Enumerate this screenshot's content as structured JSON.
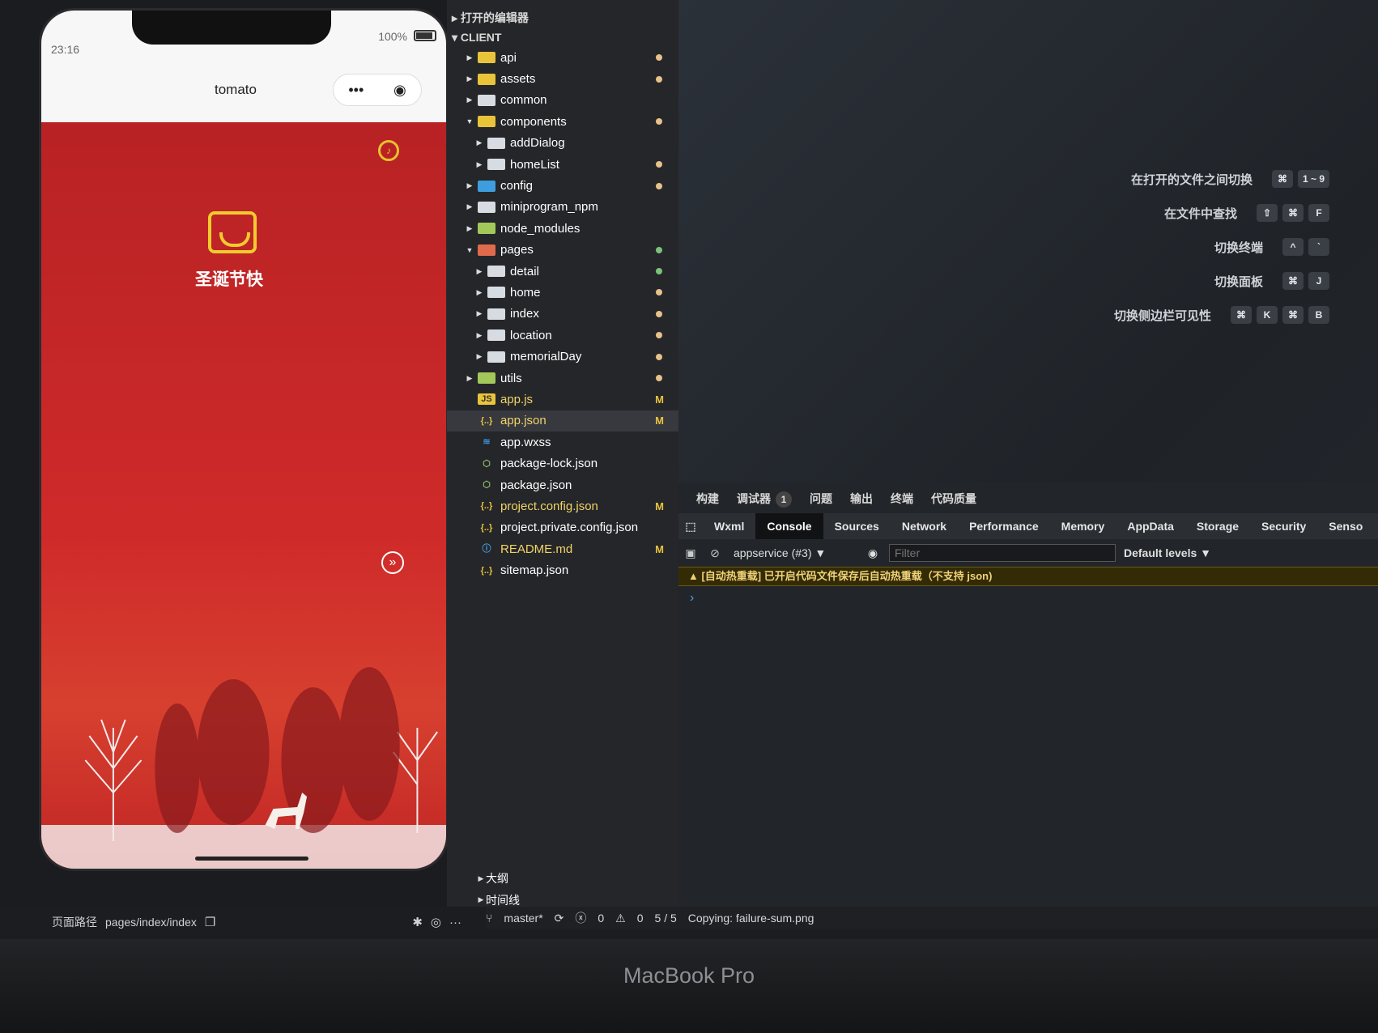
{
  "simulator": {
    "time": "23:16",
    "battery": "100%",
    "nav_title": "tomato",
    "capsule_more": "•••",
    "greeting": "圣诞节快",
    "footer": {
      "path_label": "页面路径",
      "path_value": "pages/index/index"
    }
  },
  "explorer": {
    "open_editors": "打开的编辑器",
    "root": "CLIENT",
    "items": [
      {
        "label": "api",
        "arrow": "▶",
        "icon": "folder-yellow",
        "dot": "#e8c28a",
        "mark": "",
        "indent": 1
      },
      {
        "label": "assets",
        "arrow": "▶",
        "icon": "folder-yellow",
        "dot": "#e8c28a",
        "mark": "",
        "indent": 1
      },
      {
        "label": "common",
        "arrow": "▶",
        "icon": "folder",
        "dot": "",
        "mark": "",
        "indent": 1
      },
      {
        "label": "components",
        "arrow": "▼",
        "icon": "folder-open",
        "dot": "#e8c28a",
        "mark": "",
        "indent": 1
      },
      {
        "label": "addDialog",
        "arrow": "▶",
        "icon": "folder",
        "dot": "",
        "mark": "",
        "indent": 2
      },
      {
        "label": "homeList",
        "arrow": "▶",
        "icon": "folder",
        "dot": "#e8c28a",
        "mark": "",
        "indent": 2
      },
      {
        "label": "config",
        "arrow": "▶",
        "icon": "folder-blue",
        "dot": "#e8c28a",
        "mark": "",
        "indent": 1
      },
      {
        "label": "miniprogram_npm",
        "arrow": "▶",
        "icon": "folder",
        "dot": "",
        "mark": "",
        "indent": 1
      },
      {
        "label": "node_modules",
        "arrow": "▶",
        "icon": "folder-green",
        "dot": "",
        "mark": "",
        "indent": 1
      },
      {
        "label": "pages",
        "arrow": "▼",
        "icon": "folder-red",
        "dot": "#7cc27a",
        "mark": "",
        "indent": 1
      },
      {
        "label": "detail",
        "arrow": "▶",
        "icon": "folder",
        "dot": "#7cc27a",
        "mark": "",
        "indent": 2
      },
      {
        "label": "home",
        "arrow": "▶",
        "icon": "folder",
        "dot": "#e8c28a",
        "mark": "",
        "indent": 2
      },
      {
        "label": "index",
        "arrow": "▶",
        "icon": "folder",
        "dot": "#e8c28a",
        "mark": "",
        "indent": 2
      },
      {
        "label": "location",
        "arrow": "▶",
        "icon": "folder",
        "dot": "#e8c28a",
        "mark": "",
        "indent": 2
      },
      {
        "label": "memorialDay",
        "arrow": "▶",
        "icon": "folder",
        "dot": "#e8c28a",
        "mark": "",
        "indent": 2
      },
      {
        "label": "utils",
        "arrow": "▶",
        "icon": "folder-green",
        "dot": "#e8c28a",
        "mark": "",
        "indent": 1
      },
      {
        "label": "app.js",
        "arrow": "",
        "icon": "js",
        "dot": "",
        "mark": "M",
        "indent": 1
      },
      {
        "label": "app.json",
        "arrow": "",
        "icon": "json",
        "dot": "",
        "mark": "M",
        "indent": 1,
        "selected": true
      },
      {
        "label": "app.wxss",
        "arrow": "",
        "icon": "css",
        "dot": "",
        "mark": "",
        "indent": 1
      },
      {
        "label": "package-lock.json",
        "arrow": "",
        "icon": "npm",
        "dot": "",
        "mark": "",
        "indent": 1
      },
      {
        "label": "package.json",
        "arrow": "",
        "icon": "npm",
        "dot": "",
        "mark": "",
        "indent": 1
      },
      {
        "label": "project.config.json",
        "arrow": "",
        "icon": "json",
        "dot": "",
        "mark": "M",
        "indent": 1
      },
      {
        "label": "project.private.config.json",
        "arrow": "",
        "icon": "json",
        "dot": "",
        "mark": "",
        "indent": 1
      },
      {
        "label": "README.md",
        "arrow": "",
        "icon": "info",
        "dot": "",
        "mark": "M",
        "indent": 1
      },
      {
        "label": "sitemap.json",
        "arrow": "",
        "icon": "json",
        "dot": "",
        "mark": "",
        "indent": 1
      }
    ],
    "outline": "大纲",
    "timeline": "时间线"
  },
  "shortcuts": [
    {
      "label": "在打开的文件之间切换",
      "keys": [
        "⌘",
        "1 ~ 9"
      ]
    },
    {
      "label": "在文件中查找",
      "keys": [
        "⇧",
        "⌘",
        "F"
      ]
    },
    {
      "label": "切换终端",
      "keys": [
        "^",
        "`"
      ]
    },
    {
      "label": "切换面板",
      "keys": [
        "⌘",
        "J"
      ]
    },
    {
      "label": "切换侧边栏可见性",
      "keys": [
        "⌘",
        "K",
        "⌘",
        "B"
      ]
    }
  ],
  "panel": {
    "tabs": [
      "构建",
      "调试器",
      "问题",
      "输出",
      "终端",
      "代码质量"
    ],
    "debugger_badge": "1",
    "devtools_tabs": [
      "Wxml",
      "Console",
      "Sources",
      "Network",
      "Performance",
      "Memory",
      "AppData",
      "Storage",
      "Security",
      "Senso"
    ],
    "active_devtools_tab": "Console",
    "context": "appservice (#3)",
    "filter_placeholder": "Filter",
    "levels": "Default levels ▼",
    "warning": "▲ [自动热重载] 已开启代码文件保存后自动热重载（不支持 json)",
    "prompt": "›"
  },
  "statusbar": {
    "branch": "master*",
    "errors": "0",
    "warnings": "0",
    "pages": "5 / 5",
    "message": "Copying: failure-sum.png"
  },
  "device_brand": "MacBook Pro"
}
